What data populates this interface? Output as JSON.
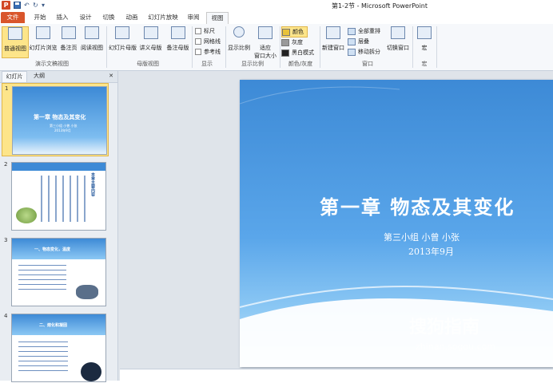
{
  "window": {
    "title": "第1-2节 - Microsoft PowerPoint",
    "app_icon": "P"
  },
  "quick_access": {
    "save": "save-icon",
    "undo": "↶",
    "redo": "↻",
    "customize": "▾"
  },
  "tabs": [
    {
      "label": "文件"
    },
    {
      "label": "开始"
    },
    {
      "label": "插入"
    },
    {
      "label": "设计"
    },
    {
      "label": "切换"
    },
    {
      "label": "动画"
    },
    {
      "label": "幻灯片放映"
    },
    {
      "label": "审阅"
    },
    {
      "label": "视图"
    }
  ],
  "ribbon": {
    "presentation_views": {
      "group_label": "演示文稿视图",
      "buttons": [
        "普通视图",
        "幻灯片浏览",
        "备注页",
        "阅读视图"
      ]
    },
    "master_views": {
      "group_label": "母版视图",
      "buttons": [
        "幻灯片母版",
        "讲义母版",
        "备注母版"
      ]
    },
    "show": {
      "group_label": "显示",
      "checkboxes": [
        "标尺",
        "网格线",
        "参考线"
      ]
    },
    "zoom": {
      "group_label": "显示比例",
      "buttons": [
        "显示比例",
        "适应",
        "窗口大小"
      ]
    },
    "color": {
      "group_label": "颜色/灰度",
      "items": [
        "颜色",
        "灰度",
        "黑白模式"
      ]
    },
    "window": {
      "group_label": "窗口",
      "new_window": "新建窗口",
      "items": [
        "全部重排",
        "层叠",
        "移动拆分"
      ],
      "switch": "切换窗口"
    },
    "macros": {
      "group_label": "宏",
      "button": "宏"
    }
  },
  "left_pane": {
    "tabs": [
      "幻灯片",
      "大纲"
    ],
    "close": "✕",
    "slides": [
      {
        "number": "1",
        "title": "第一章  物态及其变化",
        "sub": "第三小组 小曾 小张",
        "date": "2013年9月"
      },
      {
        "number": "2",
        "title": "本章主要内容"
      },
      {
        "number": "3",
        "title": "一、物态变化，温度"
      },
      {
        "number": "4",
        "title": "二、熔化和凝固"
      }
    ]
  },
  "slide": {
    "title": "第一章  物态及其变化",
    "subtitle": "第三小组 小曾 小张",
    "date": "2013年9月"
  },
  "watermark": {
    "text": "搜狗指南",
    "url": "zhinan.sogou.com"
  },
  "colors": {
    "file_tab": "#d9552b",
    "selected": "#fde58a",
    "slide_top": "#3d8ad6",
    "slide_bottom": "#cde6fb"
  }
}
